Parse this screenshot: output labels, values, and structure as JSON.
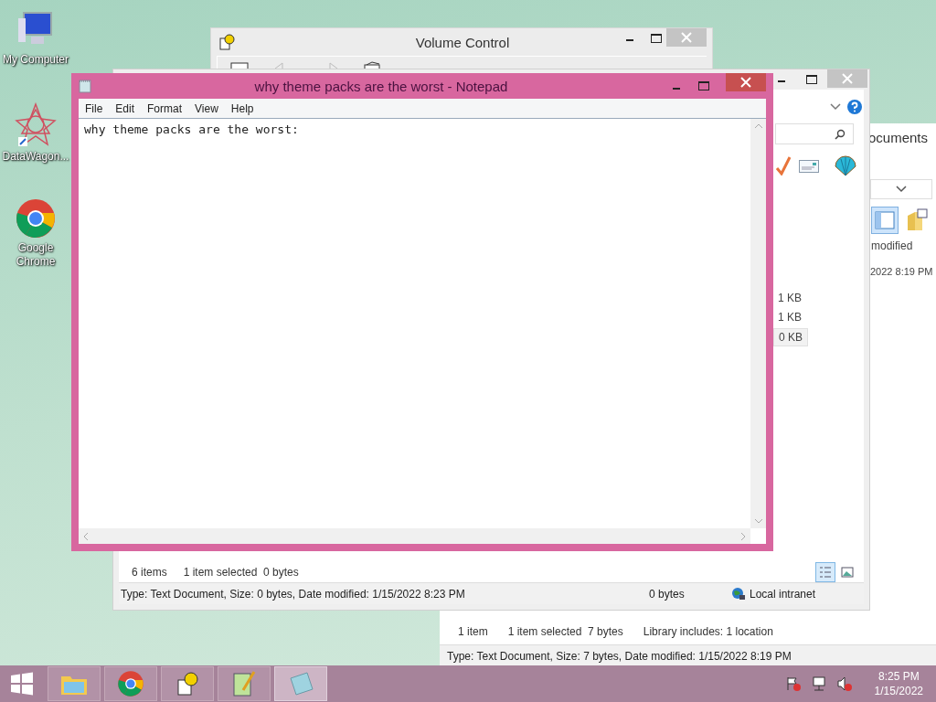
{
  "desktop_icons": [
    {
      "label": "My Computer",
      "kind": "computer"
    },
    {
      "label": "DataWagon...",
      "kind": "star"
    },
    {
      "label": "Google Chrome",
      "kind": "chrome"
    }
  ],
  "volume_window": {
    "title": "Volume Control"
  },
  "explorer_back": {
    "rows": [
      {
        "size": "1 KB",
        "selected": false
      },
      {
        "size": "1 KB",
        "selected": false
      },
      {
        "size": "0 KB",
        "selected": true
      }
    ],
    "status_items": "6 items",
    "status_selected": "1 item selected  0 bytes",
    "details": "Type: Text Document, Size: 0 bytes, Date modified: 1/15/2022 8:23 PM",
    "details_size": "0 bytes",
    "zone": "Local intranet"
  },
  "explorer_front": {
    "title": "ocuments",
    "column_header": "modified",
    "cell": "2022 8:19 PM",
    "status_items": "1 item",
    "status_selected": "1 item selected  7 bytes",
    "library": "Library includes: 1 location",
    "details": "Type: Text Document, Size: 7 bytes, Date modified: 1/15/2022 8:19 PM"
  },
  "notepad": {
    "title": "why theme packs are the worst - Notepad",
    "menu": [
      "File",
      "Edit",
      "Format",
      "View",
      "Help"
    ],
    "content": "why theme packs are the worst:"
  },
  "taskbar": {
    "apps": [
      {
        "kind": "explorer",
        "selected": false
      },
      {
        "kind": "chrome",
        "selected": false
      },
      {
        "kind": "help",
        "selected": false
      },
      {
        "kind": "notepadpp",
        "selected": false
      },
      {
        "kind": "notepad",
        "selected": true
      }
    ],
    "time": "8:25 PM",
    "date": "1/15/2022"
  }
}
